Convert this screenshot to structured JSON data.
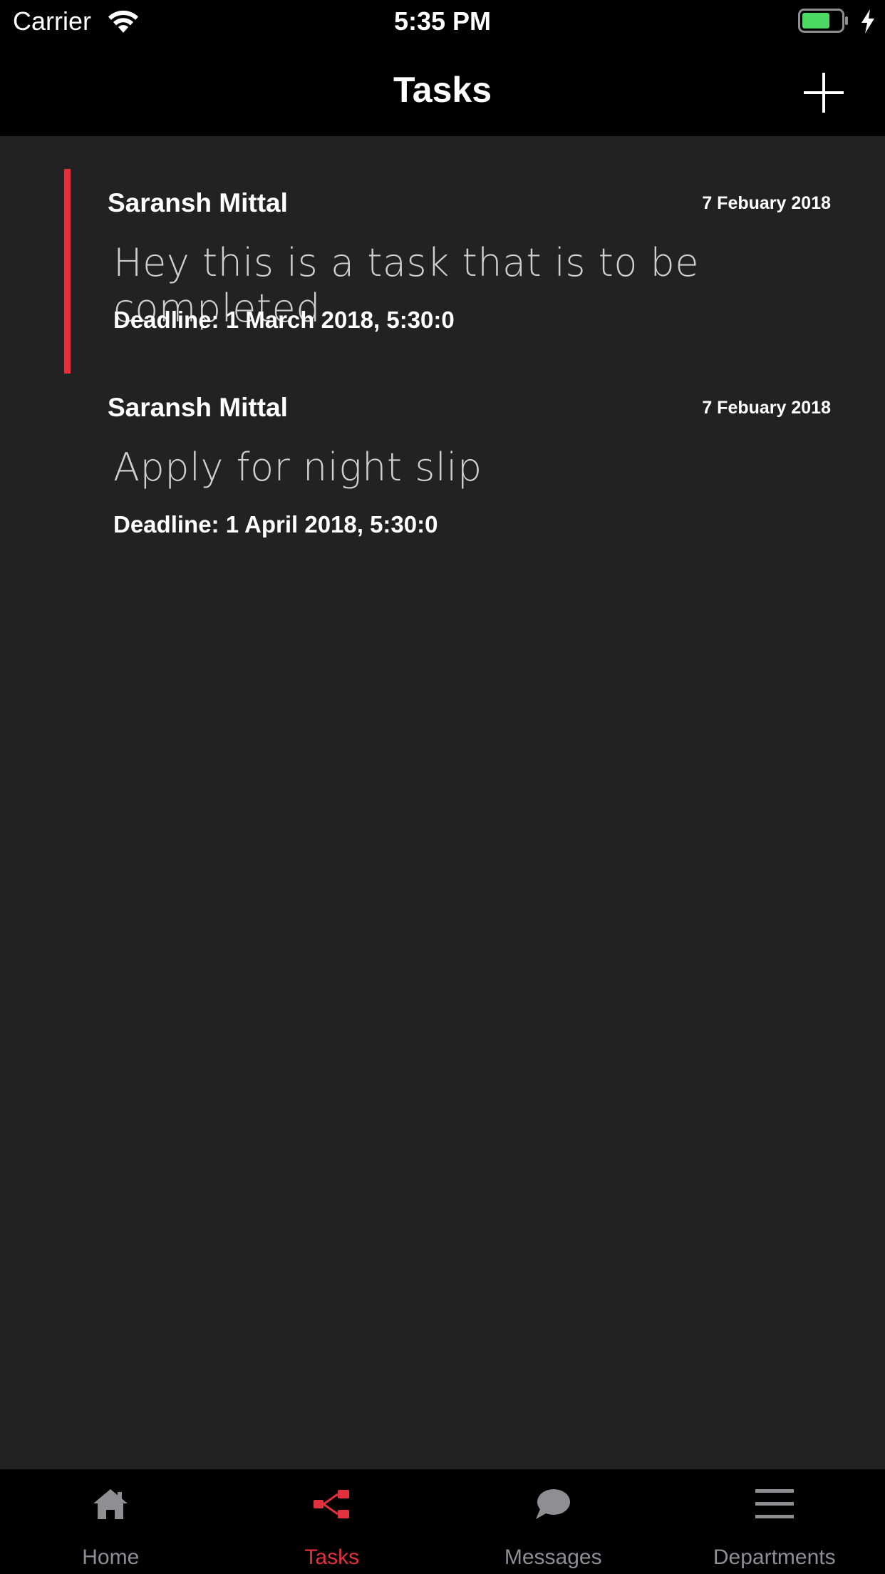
{
  "status_bar": {
    "carrier": "Carrier",
    "time": "5:35 PM",
    "battery_color": "#4cd964"
  },
  "nav": {
    "title": "Tasks",
    "add_icon": "plus-icon"
  },
  "accent_color": "#e0313e",
  "tasks": [
    {
      "author": "Saransh Mittal",
      "date": "7 Febuary 2018",
      "text": "Hey this is a task that is to be completed",
      "deadline": "Deadline: 1 March 2018, 5:30:0",
      "selected": true
    },
    {
      "author": "Saransh Mittal",
      "date": "7 Febuary 2018",
      "text": "Apply for night slip",
      "deadline": "Deadline: 1 April 2018, 5:30:0",
      "selected": false
    }
  ],
  "tabs": [
    {
      "label": "Home",
      "icon": "home-icon",
      "active": false
    },
    {
      "label": "Tasks",
      "icon": "tasks-icon",
      "active": true
    },
    {
      "label": "Messages",
      "icon": "chat-bubble-icon",
      "active": false
    },
    {
      "label": "Departments",
      "icon": "menu-icon",
      "active": false
    }
  ]
}
